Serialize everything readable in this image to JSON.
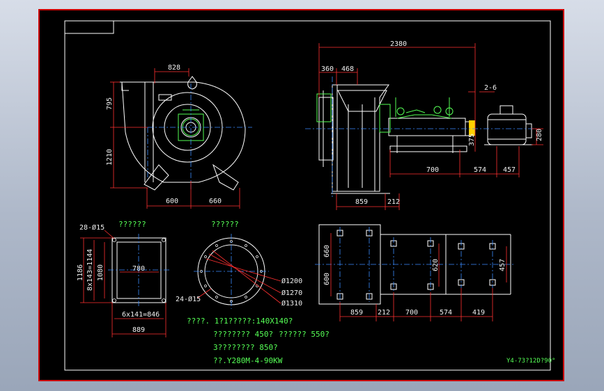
{
  "front_view": {
    "top_dim": "828",
    "left_upper_dim": "795",
    "left_lower_dim": "1210",
    "bottom_left_dim": "600",
    "bottom_right_dim": "660"
  },
  "side_view": {
    "overall_dim": "2380",
    "dim_360": "360",
    "dim_468": "468",
    "dim_2_6": "2-6",
    "dim_375": "375",
    "dim_280": "280",
    "dim_700": "700",
    "dim_574": "574",
    "dim_457": "457",
    "dim_859": "859",
    "dim_212": "212"
  },
  "outlet_flange": {
    "title": "??????",
    "holes": "28-Ø15",
    "dim_1186": "1186",
    "dim_8x143": "8x143=1144",
    "dim_1080": "1080",
    "dim_780": "780",
    "dim_6x141": "6x141=846",
    "dim_889": "889"
  },
  "inlet_flange": {
    "title": "??????",
    "d1200": "Ø1200",
    "d1270": "Ø1270",
    "d1310": "Ø1310",
    "holes": "24-Ø15"
  },
  "base_plan": {
    "dim_660": "660",
    "dim_600": "600",
    "dim_620": "620",
    "dim_457": "457",
    "dim_859": "859",
    "dim_212": "212",
    "dim_700": "700",
    "dim_574": "574",
    "dim_419": "419"
  },
  "notes": {
    "line1": "????. 1?1?????:140X140?",
    "line2": "???????? 450?",
    "line2b": "?????? 550?",
    "line3": "3???????? 850?",
    "line4": "??.Y280M-4-90KW"
  },
  "title_block": "Y4-73?12D?90°",
  "colors": {
    "background": "#000000",
    "frame": "#cc0000",
    "geometry": "#ffffff",
    "dimension": "#ff3030",
    "centerline": "#3a8cff",
    "annotation": "#55ff55",
    "coupling": "#ffd000"
  }
}
